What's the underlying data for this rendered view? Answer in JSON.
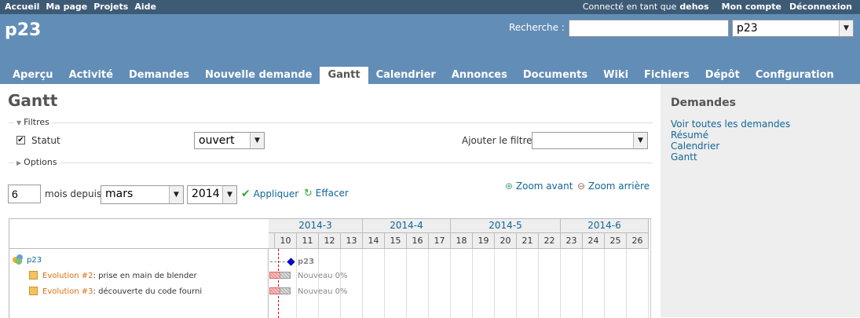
{
  "top_menu": {
    "home": "Accueil",
    "my_page": "Ma page",
    "projects": "Projets",
    "help": "Aide",
    "logged_as": "Connecté en tant que",
    "user": "dehos",
    "my_account": "Mon compte",
    "logout": "Déconnexion"
  },
  "header": {
    "project_title": "p23",
    "search_label": "Recherche :",
    "search_value": "",
    "project_jump": "p23"
  },
  "tabs": [
    {
      "label": "Aperçu"
    },
    {
      "label": "Activité"
    },
    {
      "label": "Demandes"
    },
    {
      "label": "Nouvelle demande"
    },
    {
      "label": "Gantt",
      "selected": true
    },
    {
      "label": "Calendrier"
    },
    {
      "label": "Annonces"
    },
    {
      "label": "Documents"
    },
    {
      "label": "Wiki"
    },
    {
      "label": "Fichiers"
    },
    {
      "label": "Dépôt"
    },
    {
      "label": "Configuration"
    }
  ],
  "page": {
    "title": "Gantt",
    "filters_legend": "Filtres",
    "status_label": "Statut",
    "status_checked": true,
    "status_operator": "ouvert",
    "add_filter_label": "Ajouter le filtre",
    "add_filter_value": "",
    "options_legend": "Options",
    "months": "6",
    "months_since_label": "mois depuis",
    "month_select": "mars",
    "year_select": "2014",
    "apply": "Appliquer",
    "clear": "Effacer",
    "zoom_in": "Zoom avant",
    "zoom_out": "Zoom arrière"
  },
  "gantt": {
    "months": [
      "2014-3",
      "2014-4",
      "2014-5",
      "2014-6"
    ],
    "weeks": [
      "10",
      "11",
      "12",
      "13",
      "14",
      "15",
      "16",
      "17",
      "18",
      "19",
      "20",
      "21",
      "22",
      "23",
      "24",
      "25",
      "26"
    ],
    "project": {
      "name": "p23",
      "bar_label": "p23"
    },
    "issues": [
      {
        "tracker_id": "Evolution #2",
        "subject": ": prise en main de blender",
        "bar_label": "Nouveau 0%"
      },
      {
        "tracker_id": "Evolution #3",
        "subject": ": découverte du code fourni",
        "bar_label": "Nouveau 0%"
      }
    ]
  },
  "sidebar": {
    "title": "Demandes",
    "links": [
      "Voir toutes les demandes",
      "Résumé",
      "Calendrier",
      "Gantt"
    ]
  },
  "colors": {
    "top_bar": "#3E5B76",
    "header": "#628DB6",
    "link": "#116699",
    "issue_link": "#D96F11",
    "sidebar_bg": "#EEEEEE",
    "today_line": "#DD0000"
  }
}
